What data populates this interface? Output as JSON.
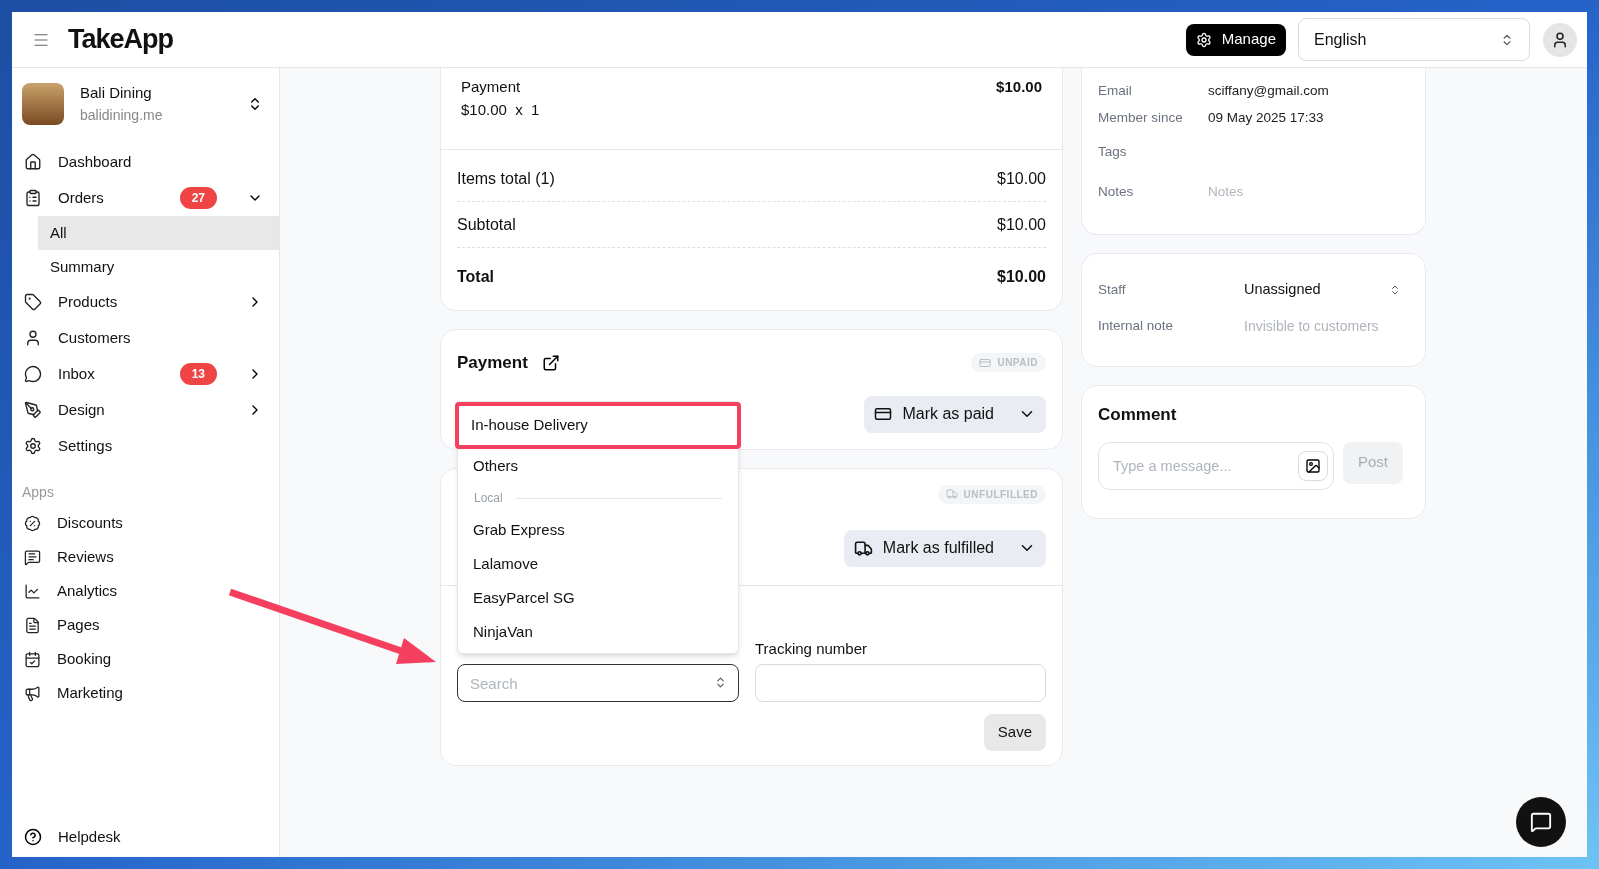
{
  "header": {
    "logo": "TakeApp",
    "manage_button": "Manage",
    "language": "English"
  },
  "store": {
    "name": "Bali Dining",
    "domain": "balidining.me"
  },
  "nav": [
    {
      "label": "Dashboard",
      "kind": "link"
    },
    {
      "label": "Orders",
      "kind": "group",
      "badge": "27",
      "expanded": true,
      "children": [
        {
          "label": "All",
          "selected": true
        },
        {
          "label": "Summary",
          "selected": false
        }
      ]
    },
    {
      "label": "Products",
      "kind": "group",
      "expanded": false
    },
    {
      "label": "Customers",
      "kind": "link"
    },
    {
      "label": "Inbox",
      "kind": "group",
      "badge": "13",
      "expanded": false
    },
    {
      "label": "Design",
      "kind": "group",
      "expanded": false
    },
    {
      "label": "Settings",
      "kind": "link"
    }
  ],
  "apps": {
    "heading": "Apps",
    "items": [
      {
        "label": "Discounts"
      },
      {
        "label": "Reviews"
      },
      {
        "label": "Analytics"
      },
      {
        "label": "Pages"
      },
      {
        "label": "Booking"
      },
      {
        "label": "Marketing"
      }
    ]
  },
  "helpdesk": "Helpdesk",
  "order": {
    "line_item": {
      "name": "Payment",
      "price_quantity": "$10.00  x  1",
      "amount": "$10.00"
    },
    "totals": [
      {
        "label": "Items total (1)",
        "value": "$10.00",
        "kind": "normal"
      },
      {
        "label": "Subtotal",
        "value": "$10.00",
        "kind": "normal"
      },
      {
        "label": "Total",
        "value": "$10.00",
        "kind": "grand"
      }
    ]
  },
  "payment": {
    "title": "Payment",
    "status": "UNPAID",
    "action": "Mark as paid"
  },
  "fulfillment": {
    "status": "UNFULFILLED",
    "action": "Mark as fulfilled",
    "courier_placeholder": "Search",
    "tracking_label": "Tracking number",
    "save": "Save",
    "courier_options": [
      {
        "kind": "option",
        "label": "In-house Delivery",
        "highlighted": true
      },
      {
        "kind": "option",
        "label": "Others",
        "highlighted": false
      },
      {
        "kind": "group",
        "label": "Local"
      },
      {
        "kind": "option",
        "label": "Grab Express",
        "highlighted": false
      },
      {
        "kind": "option",
        "label": "Lalamove",
        "highlighted": false
      },
      {
        "kind": "option",
        "label": "EasyParcel SG",
        "highlighted": false
      },
      {
        "kind": "option",
        "label": "NinjaVan",
        "highlighted": false
      }
    ]
  },
  "customer": {
    "fields": [
      {
        "label": "Email",
        "value": "sciffany@gmail.com"
      },
      {
        "label": "Member since",
        "value": "09 May 2025 17:33"
      },
      {
        "label": "Tags"
      },
      {
        "label": "Notes",
        "placeholder": "Notes"
      }
    ]
  },
  "staff": {
    "label": "Staff",
    "value": "Unassigned",
    "note_label": "Internal note",
    "note_placeholder": "Invisible to customers"
  },
  "comment": {
    "title": "Comment",
    "placeholder": "Type a message...",
    "post": "Post",
    "post_disabled": true
  }
}
